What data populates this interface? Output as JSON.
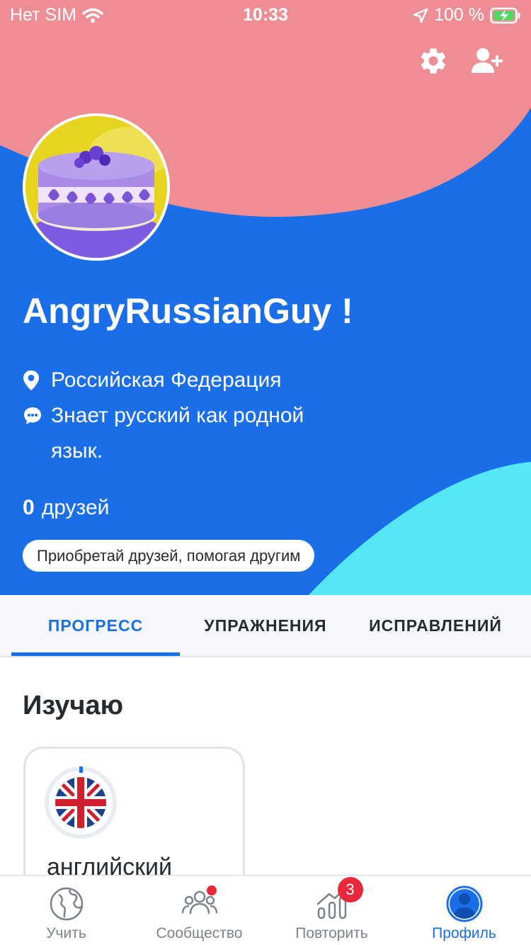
{
  "status_bar": {
    "carrier": "Нет SIM",
    "time": "10:33",
    "battery": "100 %"
  },
  "header": {
    "settings_icon": "gear-icon",
    "add_friend_icon": "user-plus-icon",
    "username": "AngryRussianGuy !",
    "location": "Российская Федерация",
    "language_line": "Знает русский как родной язык.",
    "friends_count": "0",
    "friends_label": "друзей",
    "cta_label": "Приобретай друзей, помогая другим"
  },
  "tabs": [
    {
      "label": "ПРОГРЕСС",
      "active": true
    },
    {
      "label": "УПРАЖНЕНИЯ",
      "active": false
    },
    {
      "label": "ИСПРАВЛЕНИЙ",
      "active": false
    }
  ],
  "content": {
    "section_title": "Изучаю",
    "language_card": {
      "language": "английский",
      "flag": "uk-flag"
    }
  },
  "bottom_nav": [
    {
      "label": "Учить",
      "icon": "globe-icon",
      "active": false
    },
    {
      "label": "Сообщество",
      "icon": "community-icon",
      "active": false,
      "notification_dot": true
    },
    {
      "label": "Повторить",
      "icon": "review-chart-icon",
      "active": false,
      "badge": "3"
    },
    {
      "label": "Профиль",
      "icon": "profile-icon",
      "active": true
    }
  ],
  "colors": {
    "primary_blue": "#1a6fe8",
    "header_pink": "#ee8e94",
    "header_cyan": "#55e8f4",
    "badge_red": "#e8283b"
  }
}
